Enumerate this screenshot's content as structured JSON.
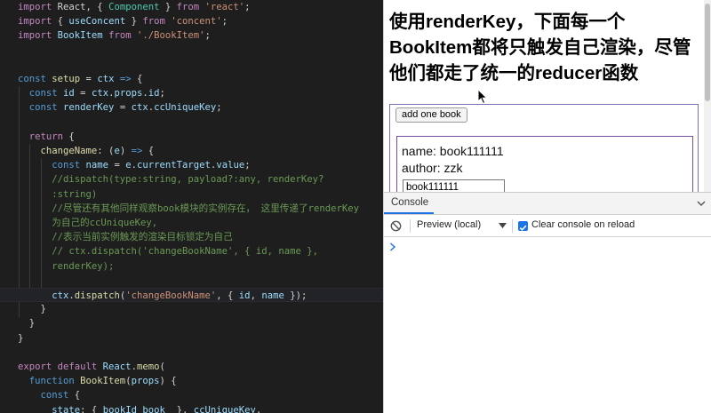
{
  "editor": {
    "lines": [
      [
        [
          "k",
          "import"
        ],
        [
          "p",
          " React, { "
        ],
        [
          "cls",
          "Component"
        ],
        [
          "p",
          " } "
        ],
        [
          "k",
          "from"
        ],
        [
          "s",
          " 'react'"
        ],
        [
          "p",
          ";"
        ]
      ],
      [
        [
          "k",
          "import"
        ],
        [
          "p",
          " { "
        ],
        [
          "v",
          "useConcent"
        ],
        [
          "p",
          " } "
        ],
        [
          "k",
          "from"
        ],
        [
          "s",
          " 'concent'"
        ],
        [
          "p",
          ";"
        ]
      ],
      [
        [
          "k",
          "import"
        ],
        [
          "v",
          " BookItem "
        ],
        [
          "k",
          "from"
        ],
        [
          "s",
          " './BookItem'"
        ],
        [
          "p",
          ";"
        ]
      ],
      [],
      [],
      [
        [
          "kb",
          "const"
        ],
        [
          "f",
          " setup "
        ],
        [
          "p",
          "= "
        ],
        [
          "v",
          "ctx"
        ],
        [
          "kb",
          " =>"
        ],
        [
          "p",
          " {"
        ]
      ],
      [
        [
          "kb",
          "  const"
        ],
        [
          "v",
          " id "
        ],
        [
          "p",
          "= "
        ],
        [
          "v",
          "ctx"
        ],
        [
          "p",
          "."
        ],
        [
          "v",
          "props"
        ],
        [
          "p",
          "."
        ],
        [
          "v",
          "id"
        ],
        [
          "p",
          ";"
        ]
      ],
      [
        [
          "kb",
          "  const"
        ],
        [
          "v",
          " renderKey "
        ],
        [
          "p",
          "= "
        ],
        [
          "v",
          "ctx"
        ],
        [
          "p",
          "."
        ],
        [
          "v",
          "ccUniqueKey"
        ],
        [
          "p",
          ";"
        ]
      ],
      [],
      [
        [
          "k",
          "  return"
        ],
        [
          "p",
          " {"
        ]
      ],
      [
        [
          "f",
          "    changeName"
        ],
        [
          "p",
          ": ("
        ],
        [
          "v",
          "e"
        ],
        [
          "p",
          ") "
        ],
        [
          "kb",
          "=>"
        ],
        [
          "p",
          " {"
        ]
      ],
      [
        [
          "kb",
          "      const"
        ],
        [
          "v",
          " name "
        ],
        [
          "p",
          "= "
        ],
        [
          "v",
          "e"
        ],
        [
          "p",
          "."
        ],
        [
          "v",
          "currentTarget"
        ],
        [
          "p",
          "."
        ],
        [
          "v",
          "value"
        ],
        [
          "p",
          ";"
        ]
      ],
      [
        [
          "c",
          "      //dispatch(type:string, payload?:any, renderKey?"
        ]
      ],
      [
        [
          "c",
          "      :string)"
        ]
      ],
      [
        [
          "c",
          "      //尽管还有其他同样观察book模块的实例存在， 这里传递了renderKey"
        ]
      ],
      [
        [
          "c",
          "      为自己的ccUniqueKey,"
        ]
      ],
      [
        [
          "c",
          "      //表示当前实例触发的渲染目标锁定为自己"
        ]
      ],
      [
        [
          "c",
          "      // ctx.dispatch('changeBookName', { id, name },"
        ]
      ],
      [
        [
          "c",
          "      renderKey);"
        ]
      ],
      [],
      [
        [
          "v",
          "      ctx"
        ],
        [
          "p",
          "."
        ],
        [
          "f",
          "dispatch"
        ],
        [
          "p",
          "("
        ],
        [
          "s",
          "'changeBookName'"
        ],
        [
          "p",
          ", { "
        ],
        [
          "v",
          "id"
        ],
        [
          "p",
          ", "
        ],
        [
          "v",
          "name"
        ],
        [
          "p",
          " });"
        ]
      ],
      [
        [
          "p",
          "    }"
        ]
      ],
      [
        [
          "p",
          "  }"
        ]
      ],
      [
        [
          "p",
          "}"
        ]
      ],
      [],
      [
        [
          "k",
          "export default"
        ],
        [
          "v",
          " React"
        ],
        [
          "p",
          "."
        ],
        [
          "f",
          "memo"
        ],
        [
          "p",
          "("
        ]
      ],
      [
        [
          "kb",
          "  function"
        ],
        [
          "f",
          " BookItem"
        ],
        [
          "p",
          "("
        ],
        [
          "v",
          "props"
        ],
        [
          "p",
          ") {"
        ]
      ],
      [
        [
          "kb",
          "    const"
        ],
        [
          "p",
          " {"
        ]
      ],
      [
        [
          "v",
          "      state"
        ],
        [
          "p",
          ": { "
        ],
        [
          "v",
          "bookId_book_"
        ],
        [
          "p",
          " }, "
        ],
        [
          "v",
          "ccUniqueKey"
        ],
        [
          "p",
          ","
        ]
      ]
    ]
  },
  "preview": {
    "heading": "使用renderKey，下面每一个BookItem都将只触发自己渲染，尽管他们都走了统一的reducer函数",
    "add_button_label": "add one book",
    "book": {
      "name_line": "name: book111111",
      "author_line": "author: zzk",
      "input_value": "book111111"
    }
  },
  "console": {
    "tab_label": "Console",
    "context_label": "Preview (local)",
    "clear_on_reload_label": "Clear console on reload",
    "clear_on_reload_checked": true
  },
  "colors": {
    "editor_bg": "#1e1e1e",
    "accent": "#1a73e8",
    "card_border": "#7a4f9b"
  }
}
